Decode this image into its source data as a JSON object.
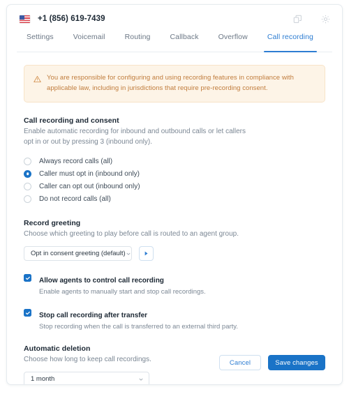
{
  "header": {
    "phone_number": "+1 (856) 619-7439",
    "flag_icon": "us-flag-icon",
    "actions": [
      {
        "name": "copy-icon",
        "label": "Copy"
      },
      {
        "name": "gear-icon",
        "label": "Settings"
      }
    ]
  },
  "tabs": [
    {
      "label": "Settings",
      "active": false
    },
    {
      "label": "Voicemail",
      "active": false
    },
    {
      "label": "Routing",
      "active": false
    },
    {
      "label": "Callback",
      "active": false
    },
    {
      "label": "Overflow",
      "active": false
    },
    {
      "label": "Call recording",
      "active": true
    }
  ],
  "warning": {
    "icon": "warning-triangle-icon",
    "text": "You are responsible for configuring and using recording features in compliance with applicable law, including in jurisdictions that require pre-recording consent."
  },
  "consent": {
    "title": "Call recording and consent",
    "description": "Enable automatic recording for inbound and outbound calls or let callers opt in or out by pressing 3 (inbound only).",
    "options": [
      {
        "label": "Always record calls (all)",
        "selected": false
      },
      {
        "label": "Caller must opt in (inbound only)",
        "selected": true
      },
      {
        "label": "Caller can opt out (inbound only)",
        "selected": false
      },
      {
        "label": "Do not record calls (all)",
        "selected": false
      }
    ]
  },
  "greeting": {
    "title": "Record greeting",
    "description": "Choose which greeting to play before call is routed to an agent group.",
    "selected": "Opt in consent greeting (default)",
    "play_icon": "play-icon"
  },
  "toggles": [
    {
      "title": "Allow agents to control call recording",
      "description": "Enable agents to manually start and stop call recordings.",
      "checked": true
    },
    {
      "title": "Stop call recording after transfer",
      "description": "Stop recording when the call is transferred to an external third party.",
      "checked": true
    }
  ],
  "deletion": {
    "title": "Automatic deletion",
    "description": "Choose how long to keep call recordings.",
    "selected": "1 month"
  },
  "footer": {
    "cancel_label": "Cancel",
    "save_label": "Save changes"
  },
  "colors": {
    "accent": "#1a73c7",
    "tab_active": "#2d7dd2",
    "warning_bg": "#fdf4e7",
    "warning_text": "#c07c3c"
  }
}
